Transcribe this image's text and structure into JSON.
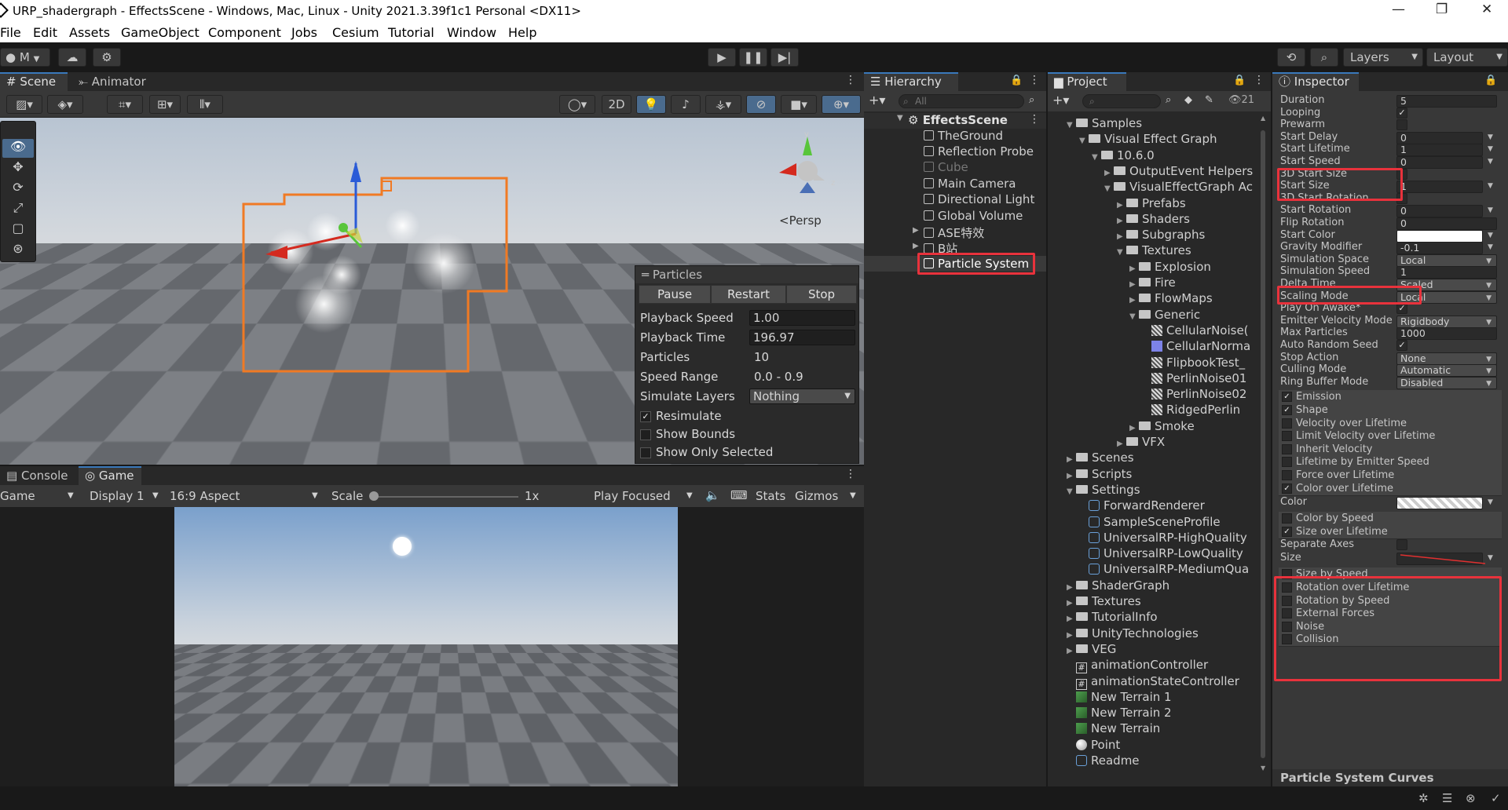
{
  "window": {
    "title": "URP_shadergraph - EffectsScene - Windows, Mac, Linux - Unity 2021.3.39f1c1 Personal <DX11>",
    "minimize": "—",
    "maximize": "❐",
    "close": "✕"
  },
  "menu": [
    "File",
    "Edit",
    "Assets",
    "GameObject",
    "Component",
    "Jobs",
    "Cesium",
    "Tutorial",
    "Window",
    "Help"
  ],
  "toolbar": {
    "account": "M",
    "layers": "Layers",
    "layout": "Layout"
  },
  "scene_panel": {
    "tabs": [
      "Scene",
      "Animator"
    ],
    "btn_2d": "2D",
    "persp": "<Persp"
  },
  "particles": {
    "title": "Particles",
    "pause": "Pause",
    "restart": "Restart",
    "stop": "Stop",
    "rows": [
      {
        "label": "Playback Speed",
        "value": "1.00"
      },
      {
        "label": "Playback Time",
        "value": "196.97"
      },
      {
        "label": "Particles",
        "value": "10"
      },
      {
        "label": "Speed Range",
        "value": "0.0 - 0.9"
      },
      {
        "label": "Simulate Layers",
        "value": "Nothing"
      }
    ],
    "resimulate": "Resimulate",
    "show_bounds": "Show Bounds",
    "show_only_selected": "Show Only Selected"
  },
  "game_panel": {
    "tabs": [
      "Console",
      "Game"
    ],
    "game_dropdown": "Game",
    "display": "Display 1",
    "aspect": "16:9 Aspect",
    "scale_label": "Scale",
    "scale_value": "1x",
    "play_focused": "Play Focused",
    "stats": "Stats",
    "gizmos": "Gizmos"
  },
  "hierarchy": {
    "title": "Hierarchy",
    "search_placeholder": "All",
    "scene": "EffectsScene",
    "items": [
      "TheGround",
      "Reflection Probe",
      "Cube",
      "Main Camera",
      "Directional Light",
      "Global Volume",
      "ASE特效",
      "B站",
      "Particle System"
    ]
  },
  "project": {
    "title": "Project",
    "count": "21",
    "items": [
      {
        "label": "Samples",
        "indent": 0,
        "kind": "folder",
        "open": true
      },
      {
        "label": "Visual Effect Graph",
        "indent": 1,
        "kind": "folder",
        "open": true
      },
      {
        "label": "10.6.0",
        "indent": 2,
        "kind": "folder",
        "open": true
      },
      {
        "label": "OutputEvent Helpers",
        "indent": 3,
        "kind": "folder",
        "open": false
      },
      {
        "label": "VisualEffectGraph Ac",
        "indent": 3,
        "kind": "folder",
        "open": true
      },
      {
        "label": "Prefabs",
        "indent": 4,
        "kind": "folder",
        "open": false
      },
      {
        "label": "Shaders",
        "indent": 4,
        "kind": "folder",
        "open": false
      },
      {
        "label": "Subgraphs",
        "indent": 4,
        "kind": "folder",
        "open": false
      },
      {
        "label": "Textures",
        "indent": 4,
        "kind": "folder",
        "open": true
      },
      {
        "label": "Explosion",
        "indent": 5,
        "kind": "folder",
        "open": false
      },
      {
        "label": "Fire",
        "indent": 5,
        "kind": "folder",
        "open": false
      },
      {
        "label": "FlowMaps",
        "indent": 5,
        "kind": "folder",
        "open": false
      },
      {
        "label": "Generic",
        "indent": 5,
        "kind": "folder",
        "open": true
      },
      {
        "label": "CellularNoise(",
        "indent": 6,
        "kind": "texture"
      },
      {
        "label": "CellularNorma",
        "indent": 6,
        "kind": "texture-blue"
      },
      {
        "label": "FlipbookTest_",
        "indent": 6,
        "kind": "texture"
      },
      {
        "label": "PerlinNoise01",
        "indent": 6,
        "kind": "texture"
      },
      {
        "label": "PerlinNoise02",
        "indent": 6,
        "kind": "texture"
      },
      {
        "label": "RidgedPerlin",
        "indent": 6,
        "kind": "texture"
      },
      {
        "label": "Smoke",
        "indent": 5,
        "kind": "folder",
        "open": false
      },
      {
        "label": "VFX",
        "indent": 4,
        "kind": "folder",
        "open": false
      },
      {
        "label": "Scenes",
        "indent": 0,
        "kind": "folder",
        "open": false
      },
      {
        "label": "Scripts",
        "indent": 0,
        "kind": "folder",
        "open": false
      },
      {
        "label": "Settings",
        "indent": 0,
        "kind": "folder",
        "open": true
      },
      {
        "label": "ForwardRenderer",
        "indent": 1,
        "kind": "asset"
      },
      {
        "label": "SampleSceneProfile",
        "indent": 1,
        "kind": "asset"
      },
      {
        "label": "UniversalRP-HighQuality",
        "indent": 1,
        "kind": "asset"
      },
      {
        "label": "UniversalRP-LowQuality",
        "indent": 1,
        "kind": "asset"
      },
      {
        "label": "UniversalRP-MediumQua",
        "indent": 1,
        "kind": "asset"
      },
      {
        "label": "ShaderGraph",
        "indent": 0,
        "kind": "folder",
        "open": false
      },
      {
        "label": "Textures",
        "indent": 0,
        "kind": "folder",
        "open": false
      },
      {
        "label": "TutorialInfo",
        "indent": 0,
        "kind": "folder",
        "open": false
      },
      {
        "label": "UnityTechnologies",
        "indent": 0,
        "kind": "folder",
        "open": false
      },
      {
        "label": "VEG",
        "indent": 0,
        "kind": "folder",
        "open": false
      },
      {
        "label": "animationController",
        "indent": 0,
        "kind": "script"
      },
      {
        "label": "animationStateController",
        "indent": 0,
        "kind": "script"
      },
      {
        "label": "New Terrain 1",
        "indent": 0,
        "kind": "terrain"
      },
      {
        "label": "New Terrain 2",
        "indent": 0,
        "kind": "terrain"
      },
      {
        "label": "New Terrain",
        "indent": 0,
        "kind": "terrain"
      },
      {
        "label": "Point",
        "indent": 0,
        "kind": "sphere"
      },
      {
        "label": "Readme",
        "indent": 0,
        "kind": "asset"
      }
    ]
  },
  "inspector": {
    "title": "Inspector",
    "fields": [
      {
        "label": "Duration",
        "value": "5",
        "type": "text"
      },
      {
        "label": "Looping",
        "value": "✓",
        "type": "check"
      },
      {
        "label": "Prewarm",
        "value": "",
        "type": "check"
      },
      {
        "label": "Start Delay",
        "value": "0",
        "type": "text",
        "dd": true
      },
      {
        "label": "Start Lifetime",
        "value": "1",
        "type": "text",
        "dd": true
      },
      {
        "label": "Start Speed",
        "value": "0",
        "type": "text",
        "dd": true
      },
      {
        "label": "3D Start Size",
        "value": "",
        "type": "check"
      },
      {
        "label": "Start Size",
        "value": "1",
        "type": "text",
        "dd": true
      },
      {
        "label": "3D Start Rotation",
        "value": "",
        "type": "check"
      },
      {
        "label": "Start Rotation",
        "value": "0",
        "type": "text",
        "dd": true
      },
      {
        "label": "Flip Rotation",
        "value": "0",
        "type": "text"
      },
      {
        "label": "Start Color",
        "value": "",
        "type": "color",
        "dd": true
      },
      {
        "label": "Gravity Modifier",
        "value": "-0.1",
        "type": "text",
        "dd": true
      },
      {
        "label": "Simulation Space",
        "value": "Local",
        "type": "select"
      },
      {
        "label": "Simulation Speed",
        "value": "1",
        "type": "text"
      },
      {
        "label": "Delta Time",
        "value": "Scaled",
        "type": "select"
      },
      {
        "label": "Scaling Mode",
        "value": "Local",
        "type": "select"
      },
      {
        "label": "Play On Awake*",
        "value": "✓",
        "type": "check"
      },
      {
        "label": "Emitter Velocity Mode",
        "value": "Rigidbody",
        "type": "select"
      },
      {
        "label": "Max Particles",
        "value": "1000",
        "type": "text"
      },
      {
        "label": "Auto Random Seed",
        "value": "✓",
        "type": "check"
      },
      {
        "label": "Stop Action",
        "value": "None",
        "type": "select"
      },
      {
        "label": "Culling Mode",
        "value": "Automatic",
        "type": "select"
      },
      {
        "label": "Ring Buffer Mode",
        "value": "Disabled",
        "type": "select"
      }
    ],
    "modules_a": [
      {
        "label": "Emission",
        "checked": "✓"
      },
      {
        "label": "Shape",
        "checked": "✓"
      },
      {
        "label": "Velocity over Lifetime",
        "checked": ""
      },
      {
        "label": "Limit Velocity over Lifetime",
        "checked": ""
      },
      {
        "label": "Inherit Velocity",
        "checked": ""
      },
      {
        "label": "Lifetime by Emitter Speed",
        "checked": ""
      },
      {
        "label": "Force over Lifetime",
        "checked": ""
      },
      {
        "label": "Color over Lifetime",
        "checked": "✓"
      }
    ],
    "color_label": "Color",
    "modules_b": [
      {
        "label": "Color by Speed",
        "checked": ""
      },
      {
        "label": "Size over Lifetime",
        "checked": "✓"
      }
    ],
    "separate_axes": "Separate Axes",
    "size_label": "Size",
    "modules_c": [
      {
        "label": "Size by Speed",
        "checked": ""
      },
      {
        "label": "Rotation over Lifetime",
        "checked": ""
      },
      {
        "label": "Rotation by Speed",
        "checked": ""
      },
      {
        "label": "External Forces",
        "checked": ""
      },
      {
        "label": "Noise",
        "checked": ""
      },
      {
        "label": "Collision",
        "checked": ""
      }
    ],
    "curves": "Particle System Curves"
  },
  "colors": {
    "highlight": "#e8323c",
    "selection_orange": "#f07a24",
    "accent_blue": "#3a79bb"
  }
}
